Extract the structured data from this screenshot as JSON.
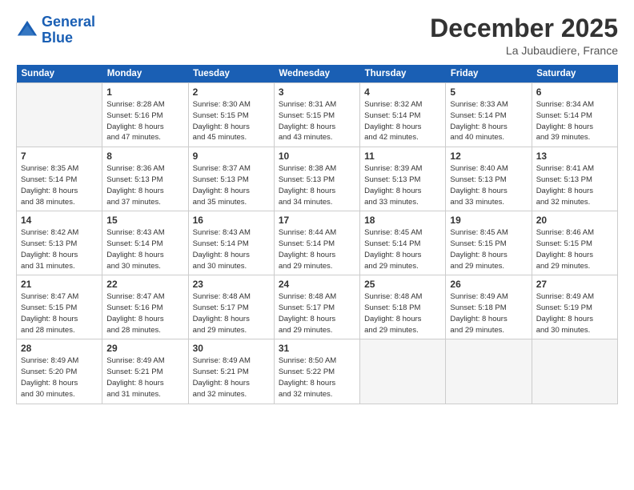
{
  "logo": {
    "line1": "General",
    "line2": "Blue"
  },
  "title": "December 2025",
  "subtitle": "La Jubaudiere, France",
  "header_days": [
    "Sunday",
    "Monday",
    "Tuesday",
    "Wednesday",
    "Thursday",
    "Friday",
    "Saturday"
  ],
  "weeks": [
    [
      {
        "day": "",
        "detail": ""
      },
      {
        "day": "1",
        "detail": "Sunrise: 8:28 AM\nSunset: 5:16 PM\nDaylight: 8 hours\nand 47 minutes."
      },
      {
        "day": "2",
        "detail": "Sunrise: 8:30 AM\nSunset: 5:15 PM\nDaylight: 8 hours\nand 45 minutes."
      },
      {
        "day": "3",
        "detail": "Sunrise: 8:31 AM\nSunset: 5:15 PM\nDaylight: 8 hours\nand 43 minutes."
      },
      {
        "day": "4",
        "detail": "Sunrise: 8:32 AM\nSunset: 5:14 PM\nDaylight: 8 hours\nand 42 minutes."
      },
      {
        "day": "5",
        "detail": "Sunrise: 8:33 AM\nSunset: 5:14 PM\nDaylight: 8 hours\nand 40 minutes."
      },
      {
        "day": "6",
        "detail": "Sunrise: 8:34 AM\nSunset: 5:14 PM\nDaylight: 8 hours\nand 39 minutes."
      }
    ],
    [
      {
        "day": "7",
        "detail": "Sunrise: 8:35 AM\nSunset: 5:14 PM\nDaylight: 8 hours\nand 38 minutes."
      },
      {
        "day": "8",
        "detail": "Sunrise: 8:36 AM\nSunset: 5:13 PM\nDaylight: 8 hours\nand 37 minutes."
      },
      {
        "day": "9",
        "detail": "Sunrise: 8:37 AM\nSunset: 5:13 PM\nDaylight: 8 hours\nand 35 minutes."
      },
      {
        "day": "10",
        "detail": "Sunrise: 8:38 AM\nSunset: 5:13 PM\nDaylight: 8 hours\nand 34 minutes."
      },
      {
        "day": "11",
        "detail": "Sunrise: 8:39 AM\nSunset: 5:13 PM\nDaylight: 8 hours\nand 33 minutes."
      },
      {
        "day": "12",
        "detail": "Sunrise: 8:40 AM\nSunset: 5:13 PM\nDaylight: 8 hours\nand 33 minutes."
      },
      {
        "day": "13",
        "detail": "Sunrise: 8:41 AM\nSunset: 5:13 PM\nDaylight: 8 hours\nand 32 minutes."
      }
    ],
    [
      {
        "day": "14",
        "detail": "Sunrise: 8:42 AM\nSunset: 5:13 PM\nDaylight: 8 hours\nand 31 minutes."
      },
      {
        "day": "15",
        "detail": "Sunrise: 8:43 AM\nSunset: 5:14 PM\nDaylight: 8 hours\nand 30 minutes."
      },
      {
        "day": "16",
        "detail": "Sunrise: 8:43 AM\nSunset: 5:14 PM\nDaylight: 8 hours\nand 30 minutes."
      },
      {
        "day": "17",
        "detail": "Sunrise: 8:44 AM\nSunset: 5:14 PM\nDaylight: 8 hours\nand 29 minutes."
      },
      {
        "day": "18",
        "detail": "Sunrise: 8:45 AM\nSunset: 5:14 PM\nDaylight: 8 hours\nand 29 minutes."
      },
      {
        "day": "19",
        "detail": "Sunrise: 8:45 AM\nSunset: 5:15 PM\nDaylight: 8 hours\nand 29 minutes."
      },
      {
        "day": "20",
        "detail": "Sunrise: 8:46 AM\nSunset: 5:15 PM\nDaylight: 8 hours\nand 29 minutes."
      }
    ],
    [
      {
        "day": "21",
        "detail": "Sunrise: 8:47 AM\nSunset: 5:15 PM\nDaylight: 8 hours\nand 28 minutes."
      },
      {
        "day": "22",
        "detail": "Sunrise: 8:47 AM\nSunset: 5:16 PM\nDaylight: 8 hours\nand 28 minutes."
      },
      {
        "day": "23",
        "detail": "Sunrise: 8:48 AM\nSunset: 5:17 PM\nDaylight: 8 hours\nand 29 minutes."
      },
      {
        "day": "24",
        "detail": "Sunrise: 8:48 AM\nSunset: 5:17 PM\nDaylight: 8 hours\nand 29 minutes."
      },
      {
        "day": "25",
        "detail": "Sunrise: 8:48 AM\nSunset: 5:18 PM\nDaylight: 8 hours\nand 29 minutes."
      },
      {
        "day": "26",
        "detail": "Sunrise: 8:49 AM\nSunset: 5:18 PM\nDaylight: 8 hours\nand 29 minutes."
      },
      {
        "day": "27",
        "detail": "Sunrise: 8:49 AM\nSunset: 5:19 PM\nDaylight: 8 hours\nand 30 minutes."
      }
    ],
    [
      {
        "day": "28",
        "detail": "Sunrise: 8:49 AM\nSunset: 5:20 PM\nDaylight: 8 hours\nand 30 minutes."
      },
      {
        "day": "29",
        "detail": "Sunrise: 8:49 AM\nSunset: 5:21 PM\nDaylight: 8 hours\nand 31 minutes."
      },
      {
        "day": "30",
        "detail": "Sunrise: 8:49 AM\nSunset: 5:21 PM\nDaylight: 8 hours\nand 32 minutes."
      },
      {
        "day": "31",
        "detail": "Sunrise: 8:50 AM\nSunset: 5:22 PM\nDaylight: 8 hours\nand 32 minutes."
      },
      {
        "day": "",
        "detail": ""
      },
      {
        "day": "",
        "detail": ""
      },
      {
        "day": "",
        "detail": ""
      }
    ]
  ]
}
